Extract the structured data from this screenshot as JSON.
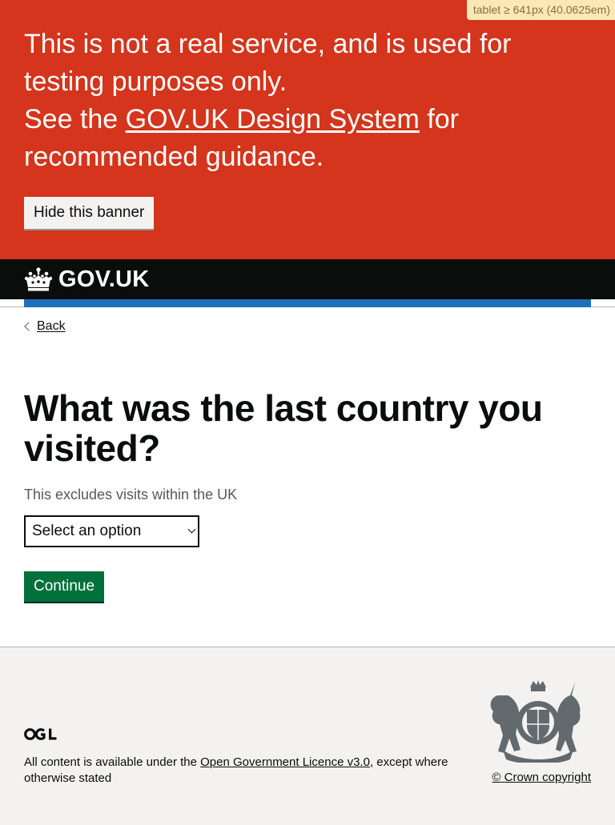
{
  "breakpoint": {
    "label": "tablet ≥ 641px (40.0625em)"
  },
  "banner": {
    "line1": "This is not a real service, and is used for testing purposes only.",
    "line2_prefix": "See the ",
    "line2_link": "GOV.UK Design System",
    "line2_suffix": " for recommended guidance.",
    "hide_label": "Hide this banner",
    "color": "#d4351c"
  },
  "header": {
    "logo_text": "GOV.UK",
    "logo_icon": "crown-icon",
    "rule_color": "#1d70b8"
  },
  "main": {
    "back_label": "Back",
    "question": "What was the last country you visited?",
    "hint": "This excludes visits within the UK",
    "select": {
      "selected": "Select an option"
    },
    "continue_label": "Continue",
    "continue_color": "#00703c"
  },
  "footer": {
    "ogl_icon": "ogl-icon",
    "licence_prefix": "All content is available under the ",
    "licence_link": "Open Government Licence v3.0",
    "licence_suffix": ", except where otherwise stated",
    "crest_icon": "royal-coat-of-arms-icon",
    "copyright": "© Crown copyright"
  }
}
